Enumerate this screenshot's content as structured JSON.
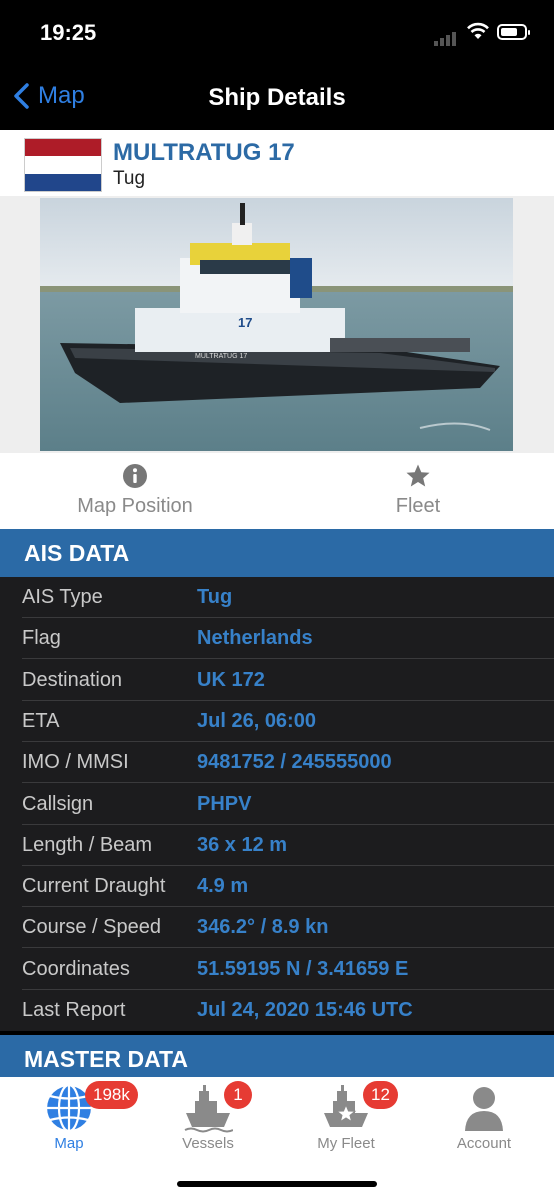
{
  "status_bar": {
    "time": "19:25"
  },
  "nav": {
    "back_label": "Map",
    "title": "Ship Details"
  },
  "ship": {
    "name": "MULTRATUG 17",
    "type": "Tug",
    "flag_colors": [
      "#ae1c28",
      "#ffffff",
      "#21468b"
    ],
    "photo_hull_text": "MULTRATUG 17",
    "photo_number": "17"
  },
  "actions": {
    "map_position": {
      "label": "Map Position",
      "icon": "info-icon"
    },
    "fleet": {
      "label": "Fleet",
      "icon": "star-icon"
    }
  },
  "ais": {
    "title": "AIS DATA",
    "rows": [
      {
        "label": "AIS Type",
        "value": "Tug"
      },
      {
        "label": "Flag",
        "value": "Netherlands"
      },
      {
        "label": "Destination",
        "value": "UK 172"
      },
      {
        "label": "ETA",
        "value": "Jul 26, 06:00"
      },
      {
        "label": "IMO / MMSI",
        "value": "9481752 / 245555000"
      },
      {
        "label": "Callsign",
        "value": "PHPV"
      },
      {
        "label": "Length / Beam",
        "value": "36 x 12 m"
      },
      {
        "label": "Current Draught",
        "value": "4.9 m"
      },
      {
        "label": "Course / Speed",
        "value": "346.2° / 8.9 kn"
      },
      {
        "label": "Coordinates",
        "value": "51.59195 N / 3.41659 E"
      },
      {
        "label": "Last Report",
        "value": "Jul 24, 2020 15:46 UTC"
      }
    ]
  },
  "master": {
    "title": "MASTER DATA"
  },
  "tabs": [
    {
      "label": "Map",
      "badge": "198k",
      "icon": "globe-icon",
      "active": true
    },
    {
      "label": "Vessels",
      "badge": "1",
      "icon": "ship-icon",
      "active": false
    },
    {
      "label": "My Fleet",
      "badge": "12",
      "icon": "fleet-ship-icon",
      "active": false
    },
    {
      "label": "Account",
      "badge": "",
      "icon": "person-icon",
      "active": false
    }
  ],
  "colors": {
    "accent": "#2f7fe2",
    "section": "#2b6aa6",
    "value": "#3781c9",
    "badge": "#e63b33"
  }
}
